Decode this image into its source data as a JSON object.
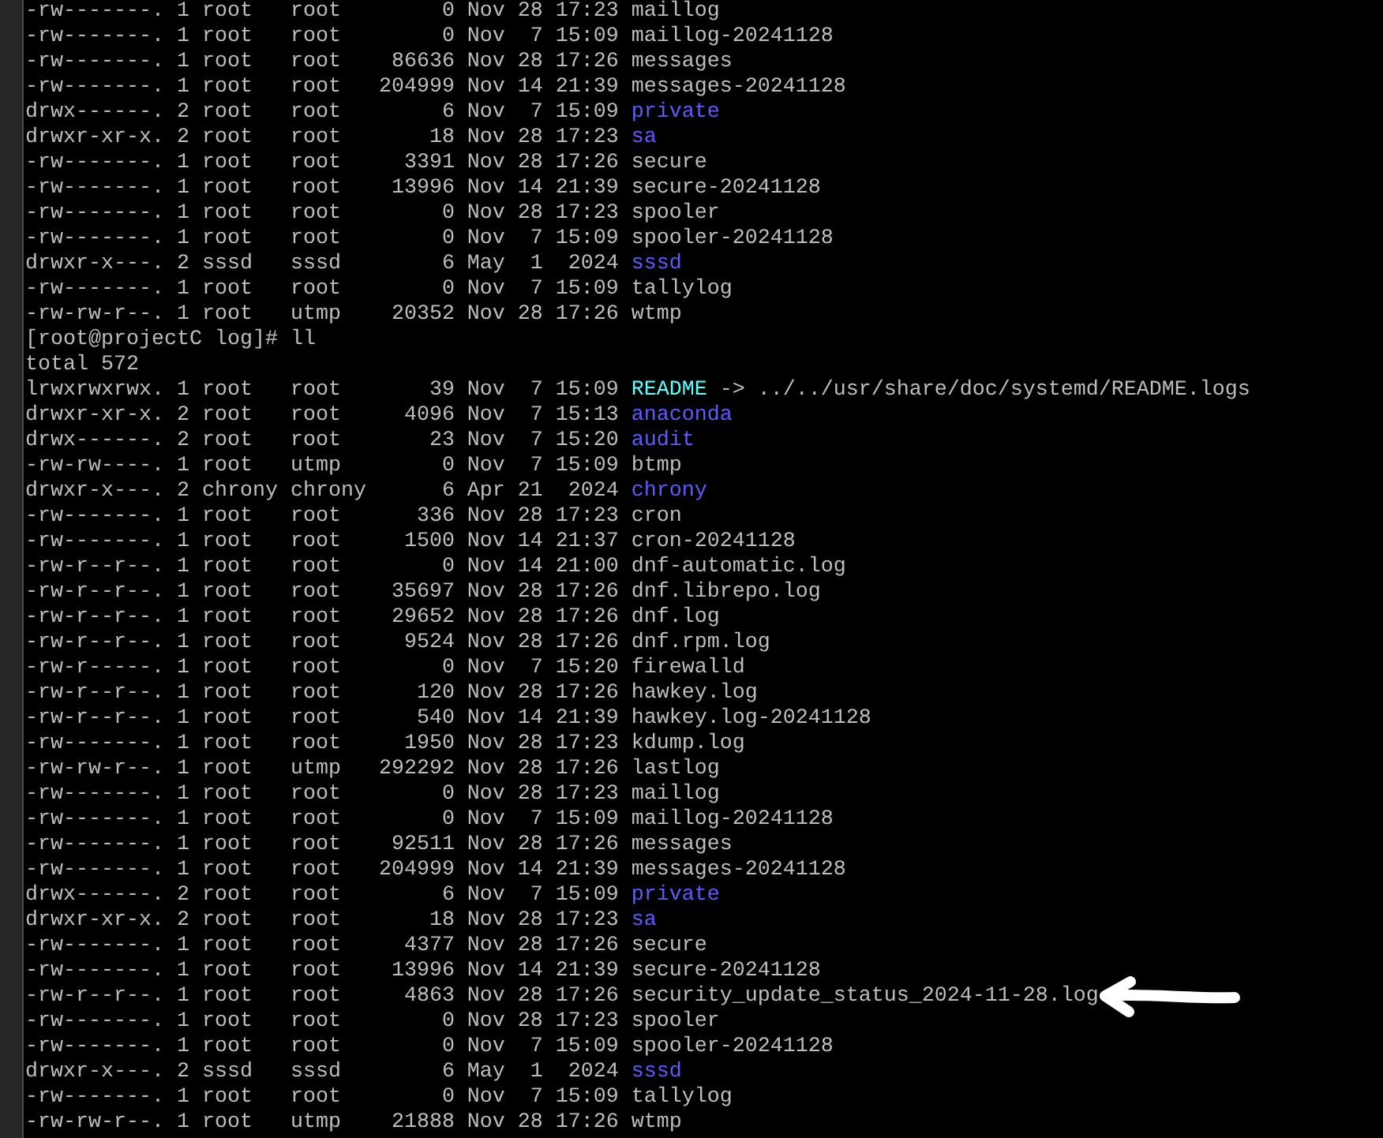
{
  "terminal": {
    "lines": [
      {
        "kind": "file",
        "mode": "-rw-------.",
        "links": "1",
        "owner": "root",
        "group": "root",
        "size": "0",
        "month": "Nov",
        "day": "28",
        "time": "17:23",
        "name": "maillog"
      },
      {
        "kind": "file",
        "mode": "-rw-------.",
        "links": "1",
        "owner": "root",
        "group": "root",
        "size": "0",
        "month": "Nov",
        "day": "7",
        "time": "15:09",
        "name": "maillog-20241128"
      },
      {
        "kind": "file",
        "mode": "-rw-------.",
        "links": "1",
        "owner": "root",
        "group": "root",
        "size": "86636",
        "month": "Nov",
        "day": "28",
        "time": "17:26",
        "name": "messages"
      },
      {
        "kind": "file",
        "mode": "-rw-------.",
        "links": "1",
        "owner": "root",
        "group": "root",
        "size": "204999",
        "month": "Nov",
        "day": "14",
        "time": "21:39",
        "name": "messages-20241128"
      },
      {
        "kind": "dir",
        "mode": "drwx------.",
        "links": "2",
        "owner": "root",
        "group": "root",
        "size": "6",
        "month": "Nov",
        "day": "7",
        "time": "15:09",
        "name": "private"
      },
      {
        "kind": "dir",
        "mode": "drwxr-xr-x.",
        "links": "2",
        "owner": "root",
        "group": "root",
        "size": "18",
        "month": "Nov",
        "day": "28",
        "time": "17:23",
        "name": "sa"
      },
      {
        "kind": "file",
        "mode": "-rw-------.",
        "links": "1",
        "owner": "root",
        "group": "root",
        "size": "3391",
        "month": "Nov",
        "day": "28",
        "time": "17:26",
        "name": "secure"
      },
      {
        "kind": "file",
        "mode": "-rw-------.",
        "links": "1",
        "owner": "root",
        "group": "root",
        "size": "13996",
        "month": "Nov",
        "day": "14",
        "time": "21:39",
        "name": "secure-20241128"
      },
      {
        "kind": "file",
        "mode": "-rw-------.",
        "links": "1",
        "owner": "root",
        "group": "root",
        "size": "0",
        "month": "Nov",
        "day": "28",
        "time": "17:23",
        "name": "spooler"
      },
      {
        "kind": "file",
        "mode": "-rw-------.",
        "links": "1",
        "owner": "root",
        "group": "root",
        "size": "0",
        "month": "Nov",
        "day": "7",
        "time": "15:09",
        "name": "spooler-20241128"
      },
      {
        "kind": "dir",
        "mode": "drwxr-x---.",
        "links": "2",
        "owner": "sssd",
        "group": "sssd",
        "size": "6",
        "month": "May",
        "day": "1",
        "time": "2024",
        "name": "sssd"
      },
      {
        "kind": "file",
        "mode": "-rw-------.",
        "links": "1",
        "owner": "root",
        "group": "root",
        "size": "0",
        "month": "Nov",
        "day": "7",
        "time": "15:09",
        "name": "tallylog"
      },
      {
        "kind": "file",
        "mode": "-rw-rw-r--.",
        "links": "1",
        "owner": "root",
        "group": "utmp",
        "size": "20352",
        "month": "Nov",
        "day": "28",
        "time": "17:26",
        "name": "wtmp"
      },
      {
        "kind": "prompt",
        "prompt": "[root@projectC log]#",
        "command": "ll"
      },
      {
        "kind": "text",
        "text": "total 572"
      },
      {
        "kind": "link",
        "mode": "lrwxrwxrwx.",
        "links": "1",
        "owner": "root",
        "group": "root",
        "size": "39",
        "month": "Nov",
        "day": "7",
        "time": "15:09",
        "name": "README",
        "target": "-> ../../usr/share/doc/systemd/README.logs"
      },
      {
        "kind": "dir",
        "mode": "drwxr-xr-x.",
        "links": "2",
        "owner": "root",
        "group": "root",
        "size": "4096",
        "month": "Nov",
        "day": "7",
        "time": "15:13",
        "name": "anaconda"
      },
      {
        "kind": "dir",
        "mode": "drwx------.",
        "links": "2",
        "owner": "root",
        "group": "root",
        "size": "23",
        "month": "Nov",
        "day": "7",
        "time": "15:20",
        "name": "audit"
      },
      {
        "kind": "file",
        "mode": "-rw-rw----.",
        "links": "1",
        "owner": "root",
        "group": "utmp",
        "size": "0",
        "month": "Nov",
        "day": "7",
        "time": "15:09",
        "name": "btmp"
      },
      {
        "kind": "dir",
        "mode": "drwxr-x---.",
        "links": "2",
        "owner": "chrony",
        "group": "chrony",
        "size": "6",
        "month": "Apr",
        "day": "21",
        "time": "2024",
        "name": "chrony"
      },
      {
        "kind": "file",
        "mode": "-rw-------.",
        "links": "1",
        "owner": "root",
        "group": "root",
        "size": "336",
        "month": "Nov",
        "day": "28",
        "time": "17:23",
        "name": "cron"
      },
      {
        "kind": "file",
        "mode": "-rw-------.",
        "links": "1",
        "owner": "root",
        "group": "root",
        "size": "1500",
        "month": "Nov",
        "day": "14",
        "time": "21:37",
        "name": "cron-20241128"
      },
      {
        "kind": "file",
        "mode": "-rw-r--r--.",
        "links": "1",
        "owner": "root",
        "group": "root",
        "size": "0",
        "month": "Nov",
        "day": "14",
        "time": "21:00",
        "name": "dnf-automatic.log"
      },
      {
        "kind": "file",
        "mode": "-rw-r--r--.",
        "links": "1",
        "owner": "root",
        "group": "root",
        "size": "35697",
        "month": "Nov",
        "day": "28",
        "time": "17:26",
        "name": "dnf.librepo.log"
      },
      {
        "kind": "file",
        "mode": "-rw-r--r--.",
        "links": "1",
        "owner": "root",
        "group": "root",
        "size": "29652",
        "month": "Nov",
        "day": "28",
        "time": "17:26",
        "name": "dnf.log"
      },
      {
        "kind": "file",
        "mode": "-rw-r--r--.",
        "links": "1",
        "owner": "root",
        "group": "root",
        "size": "9524",
        "month": "Nov",
        "day": "28",
        "time": "17:26",
        "name": "dnf.rpm.log"
      },
      {
        "kind": "file",
        "mode": "-rw-r-----.",
        "links": "1",
        "owner": "root",
        "group": "root",
        "size": "0",
        "month": "Nov",
        "day": "7",
        "time": "15:20",
        "name": "firewalld"
      },
      {
        "kind": "file",
        "mode": "-rw-r--r--.",
        "links": "1",
        "owner": "root",
        "group": "root",
        "size": "120",
        "month": "Nov",
        "day": "28",
        "time": "17:26",
        "name": "hawkey.log"
      },
      {
        "kind": "file",
        "mode": "-rw-r--r--.",
        "links": "1",
        "owner": "root",
        "group": "root",
        "size": "540",
        "month": "Nov",
        "day": "14",
        "time": "21:39",
        "name": "hawkey.log-20241128"
      },
      {
        "kind": "file",
        "mode": "-rw-------.",
        "links": "1",
        "owner": "root",
        "group": "root",
        "size": "1950",
        "month": "Nov",
        "day": "28",
        "time": "17:23",
        "name": "kdump.log"
      },
      {
        "kind": "file",
        "mode": "-rw-rw-r--.",
        "links": "1",
        "owner": "root",
        "group": "utmp",
        "size": "292292",
        "month": "Nov",
        "day": "28",
        "time": "17:26",
        "name": "lastlog"
      },
      {
        "kind": "file",
        "mode": "-rw-------.",
        "links": "1",
        "owner": "root",
        "group": "root",
        "size": "0",
        "month": "Nov",
        "day": "28",
        "time": "17:23",
        "name": "maillog"
      },
      {
        "kind": "file",
        "mode": "-rw-------.",
        "links": "1",
        "owner": "root",
        "group": "root",
        "size": "0",
        "month": "Nov",
        "day": "7",
        "time": "15:09",
        "name": "maillog-20241128"
      },
      {
        "kind": "file",
        "mode": "-rw-------.",
        "links": "1",
        "owner": "root",
        "group": "root",
        "size": "92511",
        "month": "Nov",
        "day": "28",
        "time": "17:26",
        "name": "messages"
      },
      {
        "kind": "file",
        "mode": "-rw-------.",
        "links": "1",
        "owner": "root",
        "group": "root",
        "size": "204999",
        "month": "Nov",
        "day": "14",
        "time": "21:39",
        "name": "messages-20241128"
      },
      {
        "kind": "dir",
        "mode": "drwx------.",
        "links": "2",
        "owner": "root",
        "group": "root",
        "size": "6",
        "month": "Nov",
        "day": "7",
        "time": "15:09",
        "name": "private"
      },
      {
        "kind": "dir",
        "mode": "drwxr-xr-x.",
        "links": "2",
        "owner": "root",
        "group": "root",
        "size": "18",
        "month": "Nov",
        "day": "28",
        "time": "17:23",
        "name": "sa"
      },
      {
        "kind": "file",
        "mode": "-rw-------.",
        "links": "1",
        "owner": "root",
        "group": "root",
        "size": "4377",
        "month": "Nov",
        "day": "28",
        "time": "17:26",
        "name": "secure"
      },
      {
        "kind": "file",
        "mode": "-rw-------.",
        "links": "1",
        "owner": "root",
        "group": "root",
        "size": "13996",
        "month": "Nov",
        "day": "14",
        "time": "21:39",
        "name": "secure-20241128"
      },
      {
        "kind": "file",
        "mode": "-rw-r--r--.",
        "links": "1",
        "owner": "root",
        "group": "root",
        "size": "4863",
        "month": "Nov",
        "day": "28",
        "time": "17:26",
        "name": "security_update_status_2024-11-28.log",
        "arrow": true
      },
      {
        "kind": "file",
        "mode": "-rw-------.",
        "links": "1",
        "owner": "root",
        "group": "root",
        "size": "0",
        "month": "Nov",
        "day": "28",
        "time": "17:23",
        "name": "spooler"
      },
      {
        "kind": "file",
        "mode": "-rw-------.",
        "links": "1",
        "owner": "root",
        "group": "root",
        "size": "0",
        "month": "Nov",
        "day": "7",
        "time": "15:09",
        "name": "spooler-20241128"
      },
      {
        "kind": "dir",
        "mode": "drwxr-x---.",
        "links": "2",
        "owner": "sssd",
        "group": "sssd",
        "size": "6",
        "month": "May",
        "day": "1",
        "time": "2024",
        "name": "sssd"
      },
      {
        "kind": "file",
        "mode": "-rw-------.",
        "links": "1",
        "owner": "root",
        "group": "root",
        "size": "0",
        "month": "Nov",
        "day": "7",
        "time": "15:09",
        "name": "tallylog"
      },
      {
        "kind": "file",
        "mode": "-rw-rw-r--.",
        "links": "1",
        "owner": "root",
        "group": "utmp",
        "size": "21888",
        "month": "Nov",
        "day": "28",
        "time": "17:26",
        "name": "wtmp"
      }
    ]
  }
}
